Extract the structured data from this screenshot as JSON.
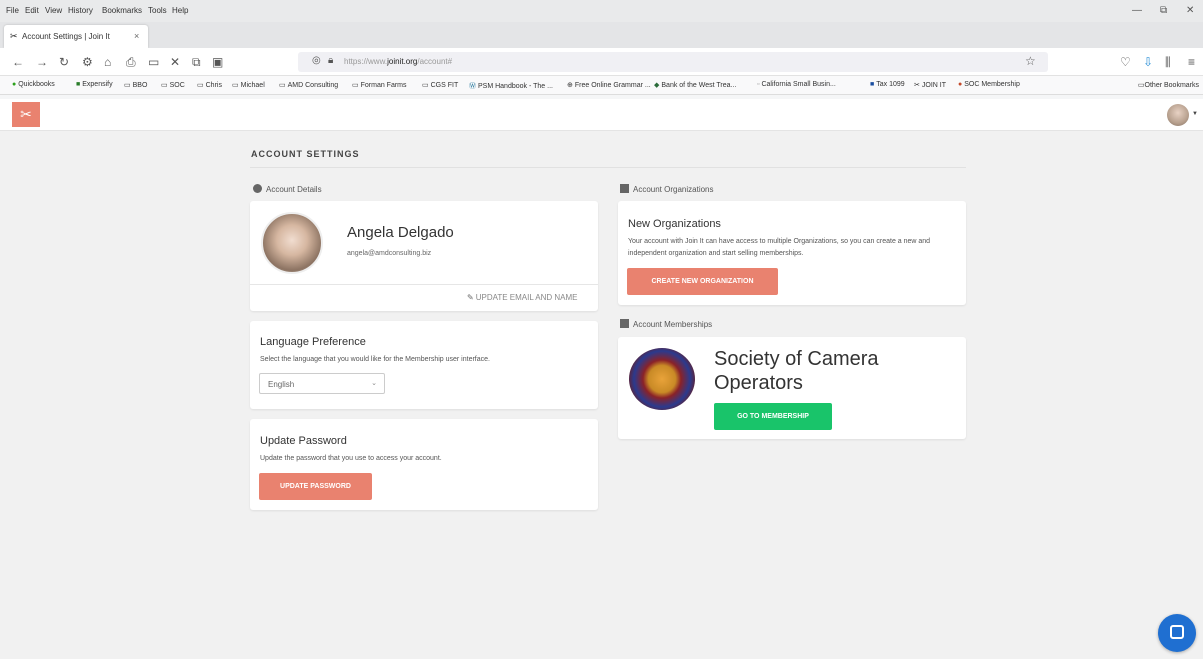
{
  "browser": {
    "menu": [
      "File",
      "Edit",
      "View",
      "History",
      "Bookmarks",
      "Tools",
      "Help"
    ],
    "window_controls": {
      "minimize": "—",
      "restore": "⧉",
      "close": "✕"
    },
    "tab": {
      "title": "Account Settings | Join It",
      "close": "×"
    },
    "new_tab": "+",
    "url_plain_prefix": "https://www.",
    "url_host": "joinit.org",
    "url_path": "/account#",
    "bookmarks": [
      "Quickbooks",
      "Expensify",
      "BBO",
      "SOC",
      "Chris",
      "Michael",
      "AMD Consulting",
      "Forman Farms",
      "CGS FIT",
      "PSM Handbook - The ...",
      "Free Online Grammar ...",
      "Bank of the West Trea...",
      "California Small Busin...",
      "Tax 1099",
      "JOIN IT",
      "SOC Membership"
    ],
    "other_bookmarks": "Other Bookmarks"
  },
  "page": {
    "title": "ACCOUNT SETTINGS",
    "account_details_heading": "Account Details",
    "account_organizations_heading": "Account Organizations",
    "account_memberships_heading": "Account Memberships"
  },
  "profile": {
    "name": "Angela Delgado",
    "email": "angela@amdconsulting.biz",
    "update_link": "UPDATE EMAIL AND NAME"
  },
  "language": {
    "title": "Language Preference",
    "description": "Select the language that you would like for the Membership user interface.",
    "selected": "English"
  },
  "password": {
    "title": "Update Password",
    "description": "Update the password that you use to access your account.",
    "button": "UPDATE PASSWORD"
  },
  "organizations": {
    "title": "New Organizations",
    "description": "Your account with Join It can have access to multiple Organizations, so you can create a new and independent organization and start selling memberships.",
    "button": "CREATE NEW ORGANIZATION"
  },
  "membership": {
    "org_name": "Society of Camera Operators",
    "button": "GO TO MEMBERSHIP"
  },
  "colors": {
    "brand_salmon": "#e9826f",
    "go_green": "#19c46a",
    "chat_blue": "#1f6fd1"
  }
}
